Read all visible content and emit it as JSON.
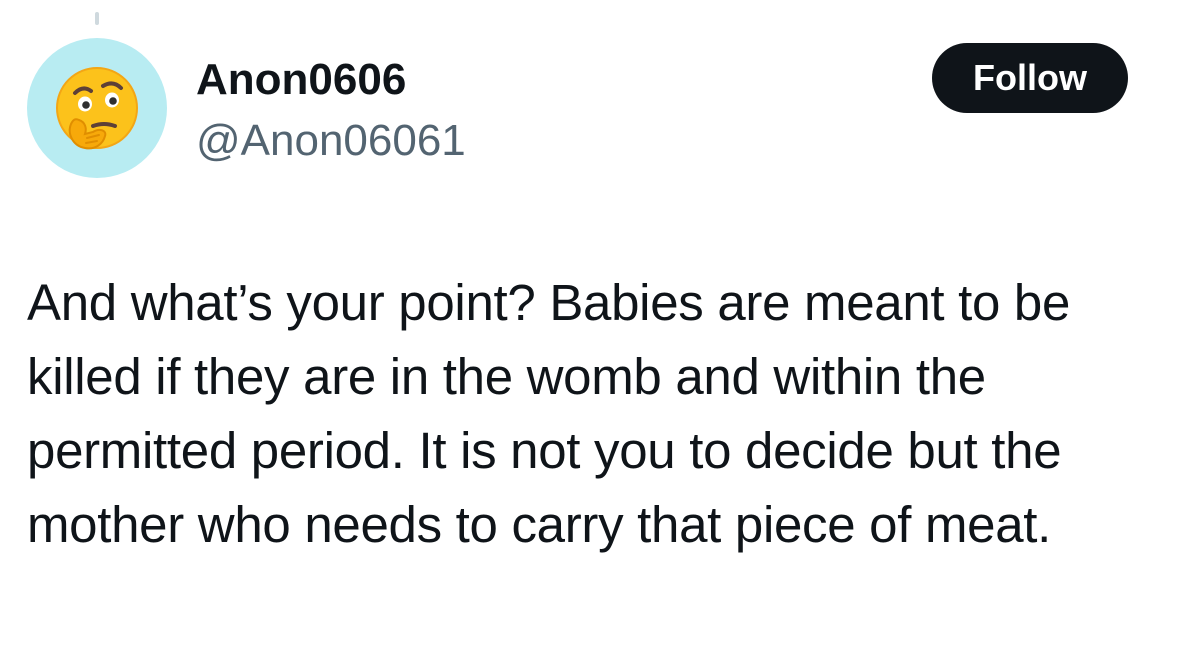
{
  "user": {
    "display_name": "Anon0606",
    "handle": "@Anon06061",
    "avatar_icon": "thinking-face-emoji",
    "avatar_bg": "#b8ecf2"
  },
  "follow_button": {
    "label": "Follow",
    "bg": "#0f1419",
    "fg": "#ffffff"
  },
  "tweet": {
    "text": "And what’s your point? Babies are meant to be killed if they are in the womb and within the permitted period. It is not you to decide but the mother who needs to carry that piece of meat."
  }
}
